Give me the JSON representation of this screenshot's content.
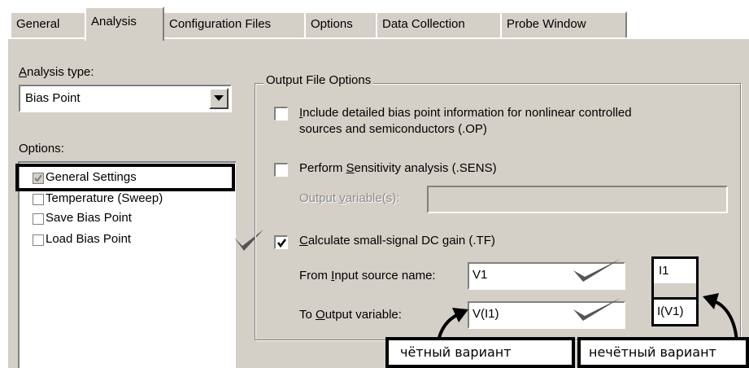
{
  "tabs": [
    {
      "label": "General"
    },
    {
      "label": "Analysis"
    },
    {
      "label": "Configuration Files"
    },
    {
      "label": "Options"
    },
    {
      "label": "Data Collection"
    },
    {
      "label": "Probe Window"
    }
  ],
  "analysis_type": {
    "label_accel": "A",
    "label_rest": "nalysis type:",
    "value": "Bias Point"
  },
  "options": {
    "label": "Options:",
    "items": [
      {
        "label": "General Settings",
        "checked": true
      },
      {
        "label": "Temperature (Sweep)",
        "checked": false
      },
      {
        "label": "Save Bias Point",
        "checked": false
      },
      {
        "label": "Load Bias Point",
        "checked": false
      }
    ]
  },
  "output_file_options": {
    "title": "Output File Options",
    "include_detailed": {
      "accel": "I",
      "line1_rest": "nclude detailed bias point information for nonlinear controlled",
      "line2": "sources and semiconductors (.OP)",
      "checked": false
    },
    "sensitivity": {
      "pre": "Perform ",
      "accel": "S",
      "post": "ensitivity analysis (.SENS)",
      "checked": false
    },
    "output_variables": {
      "pre": "Output ",
      "accel": "v",
      "post": "ariable(s):",
      "value": ""
    },
    "small_signal": {
      "accel": "C",
      "rest": "alculate small-signal DC gain (.TF)",
      "checked": true
    },
    "from_input": {
      "pre": "From ",
      "accel": "I",
      "post": "nput source name:",
      "value": "V1"
    },
    "to_output": {
      "pre": "To ",
      "accel": "O",
      "post": "utput variable:",
      "value": "V(I1)"
    }
  },
  "annotations": {
    "odd_input_value": "I1",
    "odd_output_value": "I(V1)",
    "even_variant": "чётный вариант",
    "odd_variant": "нечётный вариант"
  }
}
